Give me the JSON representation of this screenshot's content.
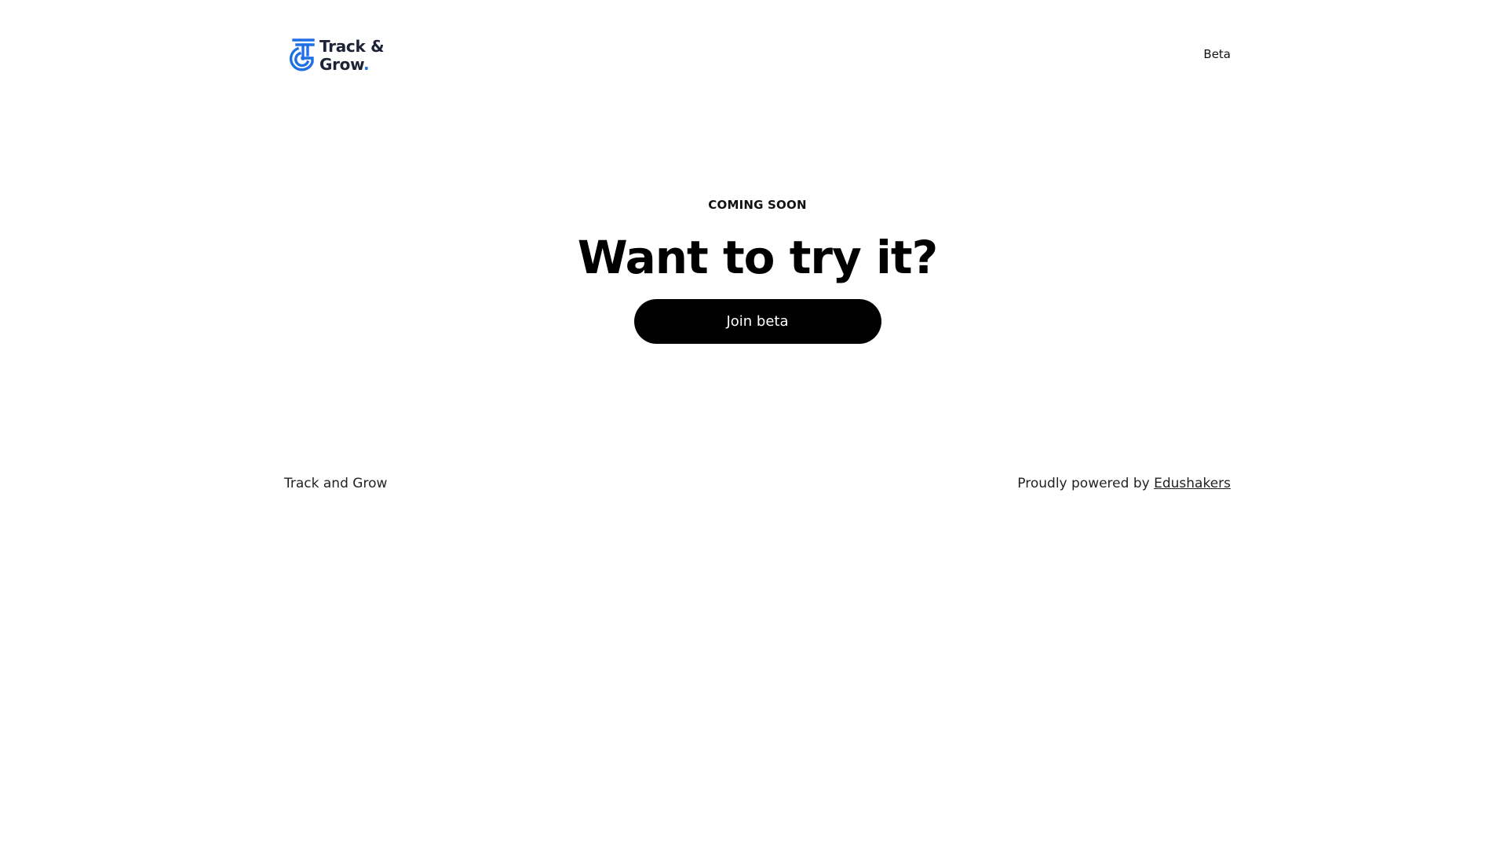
{
  "header": {
    "logo": {
      "line1": "Track &",
      "line2": "Grow",
      "dot": ".",
      "icon": "tg-monogram-logo-icon",
      "icon_color": "#1f6fe5"
    },
    "nav_beta": "Beta"
  },
  "hero": {
    "eyebrow": "COMING SOON",
    "headline": "Want to try it?",
    "cta_label": "Join beta",
    "cta_color": "#000000"
  },
  "footer": {
    "site_name": "Track and Grow",
    "powered_prefix": "Proudly powered by ",
    "powered_link": "Edushakers"
  }
}
